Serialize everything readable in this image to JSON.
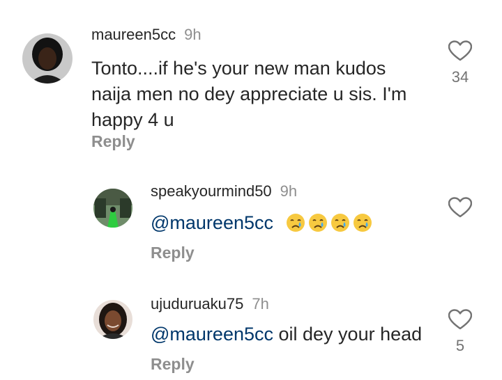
{
  "comments": [
    {
      "username": "maureen5cc",
      "time": "9h",
      "lines": [
        "Tonto....if he's your new man kudos",
        "naija men no dey appreciate u sis. I'm",
        "happy 4 u"
      ],
      "reply_label": "Reply",
      "likes": "34"
    },
    {
      "username": "speakyourmind50",
      "time": "9h",
      "mention": "@maureen5cc",
      "text": "",
      "emojis": [
        "crying-face",
        "crying-face",
        "crying-face",
        "crying-face"
      ],
      "reply_label": "Reply",
      "likes": ""
    },
    {
      "username": "ujuduruaku75",
      "time": "7h",
      "mention": "@maureen5cc",
      "text": " oil dey your head",
      "reply_label": "Reply",
      "likes": "5"
    }
  ],
  "icons": {
    "like": "heart-outline-icon",
    "emoji": "crying-face-emoji"
  },
  "colors": {
    "text": "#262626",
    "secondary": "#8e8e8e",
    "mention": "#00376b"
  }
}
